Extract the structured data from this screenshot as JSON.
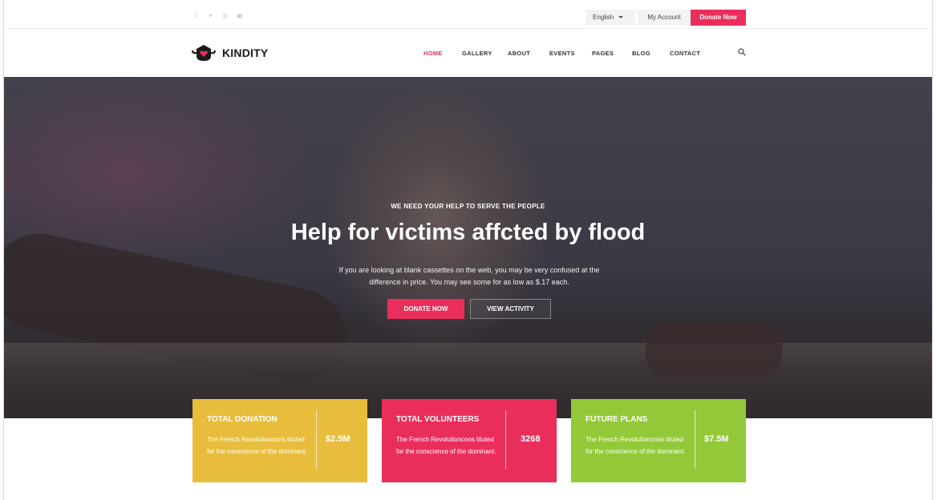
{
  "topbar": {
    "social_icons": [
      "facebook-icon",
      "twitter-icon",
      "dribbble-icon",
      "behance-icon"
    ],
    "language": "English",
    "account": "My Account",
    "donate": "Donate Now"
  },
  "brand": {
    "name": "KINDITY",
    "accent": "#ea2e5b"
  },
  "nav": {
    "items": [
      {
        "label": "HOME",
        "active": true
      },
      {
        "label": "GALLERY"
      },
      {
        "label": "ABOUT"
      },
      {
        "label": "EVENTS"
      },
      {
        "label": "PAGES"
      },
      {
        "label": "BLOG"
      },
      {
        "label": "CONTACT"
      }
    ]
  },
  "hero": {
    "subtitle": "WE NEED YOUR HELP TO SERVE THE PEOPLE",
    "title": "Help for victims affcted by flood",
    "text": "If you are looking at blank cassettes on the web, you may be very confused at the difference in price. You may see some for as low as $.17 each.",
    "primary_button": "DONATE NOW",
    "secondary_button": "VIEW ACTIVITY"
  },
  "cards": [
    {
      "title": "TOTAL DONATION",
      "text": "The French Revolutioncons tituted for the conscience of the dominant.",
      "value": "$2.5M",
      "color": "#e8bd3b"
    },
    {
      "title": "TOTAL VOLUNTEERS",
      "text": "The French Revolutioncons tituted for the conscience of the dominant.",
      "value": "3268",
      "color": "#ea2e5b"
    },
    {
      "title": "FUTURE PLANS",
      "text": "The French Revolutioncons tituted for the conscience of the dominant.",
      "value": "$7.5M",
      "color": "#93c939"
    }
  ]
}
